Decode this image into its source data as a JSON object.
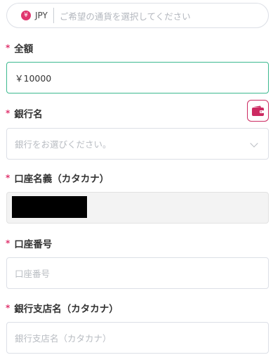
{
  "currency": {
    "badge_symbol": "¥",
    "code": "JPY",
    "placeholder": "ご希望の通貨を選択してください"
  },
  "amount": {
    "required_mark": "*",
    "label": "全額",
    "value": "￥10000"
  },
  "bank_name": {
    "required_mark": "*",
    "label": "銀行名",
    "placeholder": "銀行をお選びください。"
  },
  "account_holder": {
    "required_mark": "*",
    "label": "口座名義（カタカナ）"
  },
  "account_number": {
    "required_mark": "*",
    "label": "口座番号",
    "placeholder": "口座番号"
  },
  "branch_name": {
    "required_mark": "*",
    "label": "銀行支店名（カタカナ）",
    "placeholder": "銀行支店名（カタカナ）"
  },
  "colors": {
    "accent_pink": "#e0346e",
    "active_border": "#3cb98f",
    "placeholder_text": "#b8bcc2"
  },
  "icons": {
    "wallet": "wallet-icon",
    "chevron": "chevron-down-icon",
    "yen_badge": "yen-badge-icon"
  }
}
